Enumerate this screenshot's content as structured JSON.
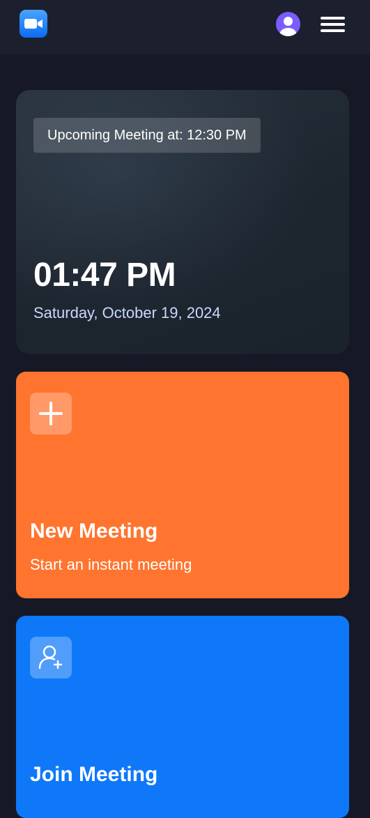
{
  "header": {
    "logo_icon": "video-camera-logo-icon",
    "avatar_icon": "user-avatar-icon",
    "menu_icon": "hamburger-menu-icon"
  },
  "hero": {
    "upcoming": "Upcoming Meeting at: 12:30 PM",
    "time": "01:47 PM",
    "date": "Saturday, October 19, 2024"
  },
  "cards": [
    {
      "title": "New Meeting",
      "description": "Start an instant meeting",
      "icon": "plus-icon",
      "color": "#ff742e"
    },
    {
      "title": "Join Meeting",
      "icon": "add-user-icon",
      "color": "#0e78f9"
    }
  ],
  "colors": {
    "background": "#161925",
    "navbar": "#1c1f2e",
    "date_text": "#c9d9ff",
    "avatar": "#7b5cff"
  }
}
